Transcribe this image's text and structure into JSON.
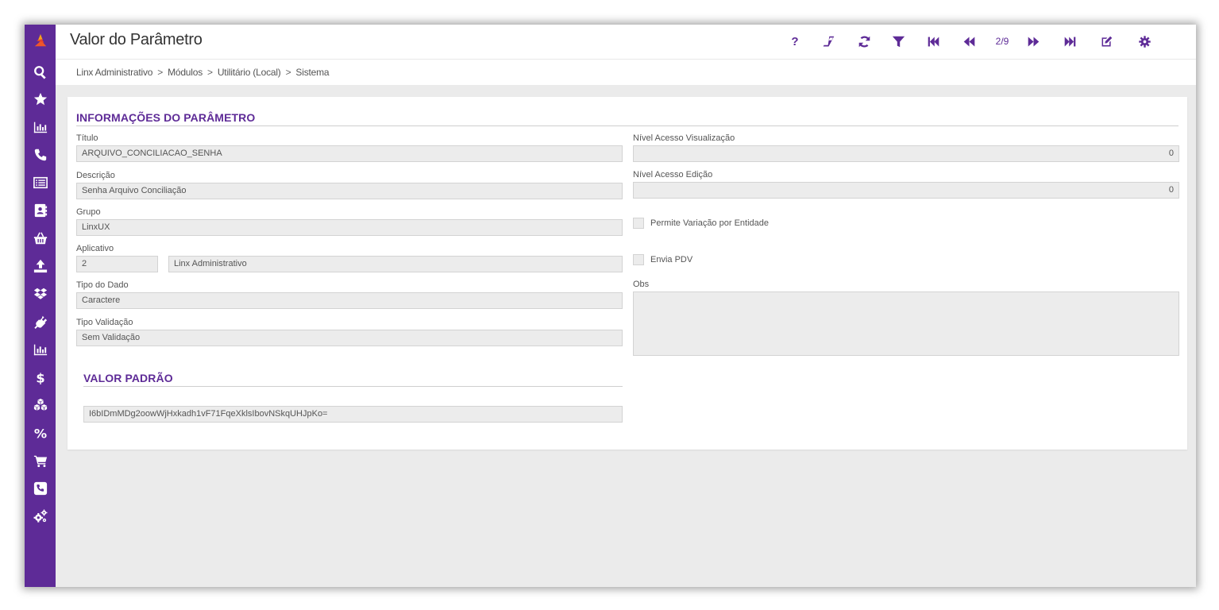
{
  "window": {
    "title": "Valor do Parâmetro"
  },
  "toolbar": {
    "help": "?",
    "pager": "2/9",
    "icons": [
      "help-icon",
      "eraser-icon",
      "refresh-icon",
      "filter-icon",
      "first-icon",
      "previous-icon",
      "next-icon",
      "last-icon",
      "edit-icon",
      "settings-icon",
      "menu-icon"
    ]
  },
  "breadcrumb": {
    "items": [
      "Linx Administrativo",
      "Módulos",
      "Utilitário (Local)",
      "Sistema"
    ],
    "separator": ">"
  },
  "sidebar": {
    "icons": [
      "logo-icon",
      "search-icon",
      "star-icon",
      "bar-chart-icon",
      "phone-icon",
      "list-icon",
      "contacts-icon",
      "basket-icon",
      "upload-icon",
      "dropbox-icon",
      "plug-icon",
      "bar-chart-icon",
      "dollar-icon",
      "cubes-icon",
      "percent-icon",
      "cart-icon",
      "phone-square-icon",
      "cogs-icon"
    ]
  },
  "section_info": {
    "title": "INFORMAÇÕES DO PARÂMETRO",
    "titulo_label": "Título",
    "titulo_value": "ARQUIVO_CONCILIACAO_SENHA",
    "descricao_label": "Descrição",
    "descricao_value": "Senha Arquivo Conciliação",
    "grupo_label": "Grupo",
    "grupo_value": "LinxUX",
    "aplicativo_label": "Aplicativo",
    "aplicativo_code": "2",
    "aplicativo_name": "Linx Administrativo",
    "tipo_dado_label": "Tipo do Dado",
    "tipo_dado_value": "Caractere",
    "tipo_validacao_label": "Tipo Validação",
    "tipo_validacao_value": "Sem Validação",
    "nivel_vis_label": "Nível Acesso Visualização",
    "nivel_vis_value": "0",
    "nivel_edi_label": "Nível Acesso Edição",
    "nivel_edi_value": "0",
    "permite_variacao_label": "Permite Variação por Entidade",
    "envia_pdv_label": "Envia PDV",
    "obs_label": "Obs",
    "obs_value": ""
  },
  "section_valor": {
    "title": "VALOR PADRÃO",
    "value": "I6bIDmMDg2oowWjHxkadh1vF71FqeXklsIbovNSkqUHJpKo="
  },
  "colors": {
    "accent": "#5e2b97",
    "logo": "#f0562a"
  }
}
